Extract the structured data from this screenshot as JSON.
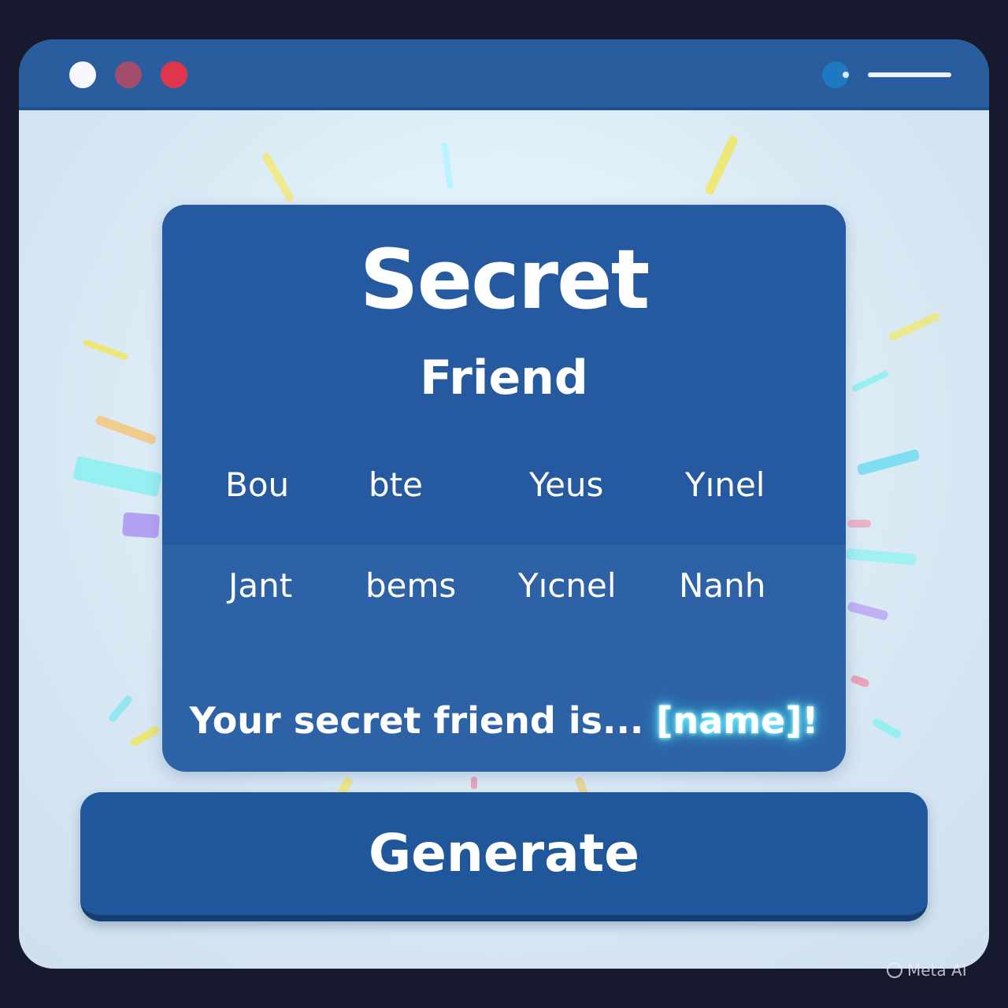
{
  "window": {
    "controls": [
      {
        "name": "close",
        "color": "#f6f7fb"
      },
      {
        "name": "minimize",
        "color": "#a24d6c"
      },
      {
        "name": "maximize",
        "color": "#e0364c"
      }
    ]
  },
  "card": {
    "title": "Secret",
    "subtitle": "Friend",
    "names_row_1": [
      "Bou",
      "bte",
      "Yeus",
      "Yınel"
    ],
    "names_row_2": [
      "Jant",
      "bems",
      "Yıcnel",
      "Nanh"
    ],
    "result_prefix": "Your secret friend is...",
    "result_name": "[name]!"
  },
  "actions": {
    "generate_label": "Generate"
  },
  "watermark": {
    "text": "Meta AI"
  },
  "colors": {
    "background": "#171a2e",
    "titlebar": "#2a5d9e",
    "card": "#2d63a6",
    "card_top": "#2559a0",
    "button": "#1f579a",
    "glow": "#40e0ff"
  }
}
